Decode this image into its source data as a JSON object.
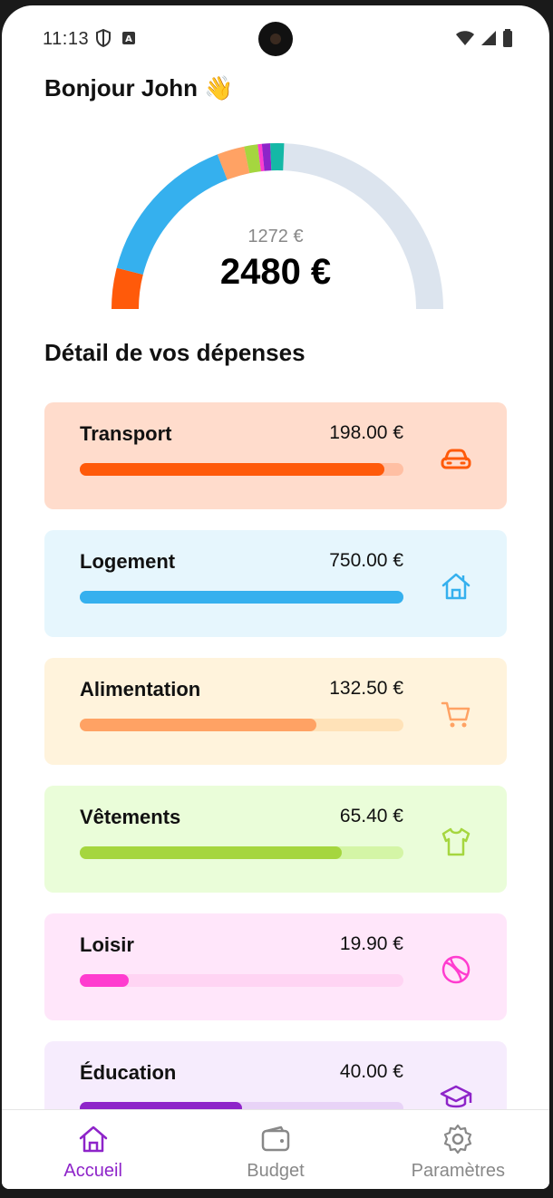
{
  "status_bar": {
    "time": "11:13"
  },
  "greeting": "Bonjour John 👋",
  "gauge": {
    "remaining_label": "1272 €",
    "total_label": "2480 €",
    "total_value": 2480,
    "track_color": "#dce4ee"
  },
  "section_title": "Détail de vos dépenses",
  "categories": [
    {
      "name": "Transport",
      "amount": "198.00 €",
      "value": 198.0,
      "progress": 0.94,
      "color": "#ff5a0a",
      "track": "#ffbfa3",
      "bg": "#ffdccc",
      "icon": "car-icon"
    },
    {
      "name": "Logement",
      "amount": "750.00 €",
      "value": 750.0,
      "progress": 1.0,
      "color": "#35b0ee",
      "track": "#b9e3f8",
      "bg": "#e6f6fd",
      "icon": "house-icon"
    },
    {
      "name": "Alimentation",
      "amount": "132.50 €",
      "value": 132.5,
      "progress": 0.73,
      "color": "#ffa264",
      "track": "#ffe2b8",
      "bg": "#fff3dc",
      "icon": "cart-icon"
    },
    {
      "name": "Vêtements",
      "amount": "65.40 €",
      "value": 65.4,
      "progress": 0.81,
      "color": "#a5d63f",
      "track": "#d4f5a6",
      "bg": "#eafdd9",
      "icon": "shirt-icon"
    },
    {
      "name": "Loisir",
      "amount": "19.90 €",
      "value": 19.9,
      "progress": 0.15,
      "color": "#ff3ccf",
      "track": "#ffd4f3",
      "bg": "#ffe6fa",
      "icon": "ball-icon"
    },
    {
      "name": "Éducation",
      "amount": "40.00 €",
      "value": 40.0,
      "progress": 0.5,
      "color": "#8e24c9",
      "track": "#e8d3f7",
      "bg": "#f6ecfd",
      "icon": "graduation-cap-icon"
    }
  ],
  "gauge_extra_segment": {
    "color": "#14b8a6",
    "value": 66.2
  },
  "nav": {
    "items": [
      {
        "label": "Accueil",
        "icon": "home-icon",
        "active": true
      },
      {
        "label": "Budget",
        "icon": "wallet-icon",
        "active": false
      },
      {
        "label": "Paramètres",
        "icon": "gear-icon",
        "active": false
      }
    ],
    "active_color": "#8e24c9",
    "inactive_color": "#888888"
  }
}
